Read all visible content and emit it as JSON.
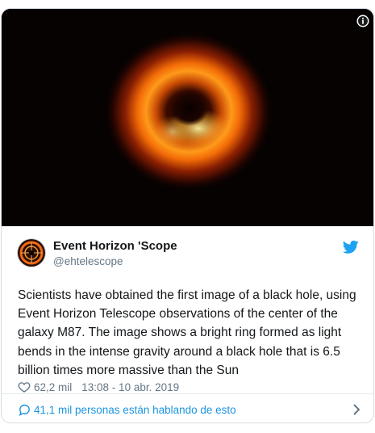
{
  "tweet": {
    "author": {
      "name": "Event Horizon 'Scope",
      "handle": "@ehtelescope",
      "avatar_icon": "eht-logo"
    },
    "text": "Scientists have obtained the first image of a black hole, using Event Horizon Telescope observations of the center of the galaxy M87. The image shows a bright ring formed as light bends in the intense gravity around a black hole that is 6.5 billion times more massive than the Sun",
    "likes": "62,2 mil",
    "timestamp": "13:08 - 10 abr. 2019",
    "conversation": "41,1 mil personas están hablando de esto"
  },
  "colors": {
    "accent": "#1da1f2",
    "link": "#1b95e0",
    "text": "#14171a",
    "muted": "#657786",
    "border": "#e1e8ed"
  }
}
